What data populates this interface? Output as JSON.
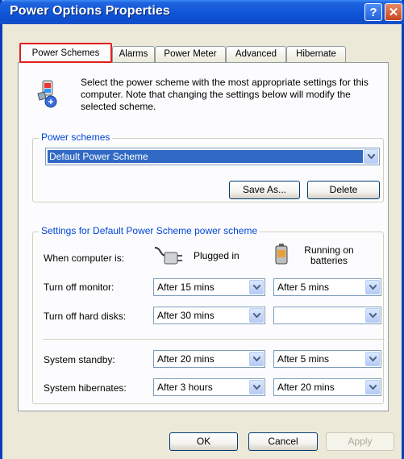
{
  "window": {
    "title": "Power Options Properties",
    "help_label": "?",
    "close_label": "✕"
  },
  "tabs": [
    {
      "label": "Power Schemes",
      "active": true
    },
    {
      "label": "Alarms"
    },
    {
      "label": "Power Meter"
    },
    {
      "label": "Advanced"
    },
    {
      "label": "Hibernate"
    }
  ],
  "intro": "Select the power scheme with the most appropriate settings for this computer. Note that changing the settings below will modify the selected scheme.",
  "power_schemes": {
    "group_label": "Power schemes",
    "selected": "Default Power Scheme",
    "save_as_label": "Save As...",
    "delete_label": "Delete"
  },
  "settings": {
    "group_label": "Settings for Default Power Scheme power scheme",
    "when_label": "When computer is:",
    "plugged_label": "Plugged in",
    "batteries_label": "Running on batteries",
    "rows": [
      {
        "label": "Turn off monitor:",
        "plugged": "After 15 mins",
        "batteries": "After 5 mins"
      },
      {
        "label": "Turn off hard disks:",
        "plugged": "After 30 mins",
        "batteries": ""
      },
      {
        "label": "System standby:",
        "plugged": "After 20 mins",
        "batteries": "After 5 mins"
      },
      {
        "label": "System hibernates:",
        "plugged": "After 3 hours",
        "batteries": "After 20 mins"
      }
    ]
  },
  "buttons": {
    "ok_label": "OK",
    "cancel_label": "Cancel",
    "apply_label": "Apply"
  },
  "colors": {
    "title_bar": "#1156d8",
    "tab_highlight": "#e0201d",
    "selection": "#316ac5",
    "group_label": "#0046d5"
  }
}
